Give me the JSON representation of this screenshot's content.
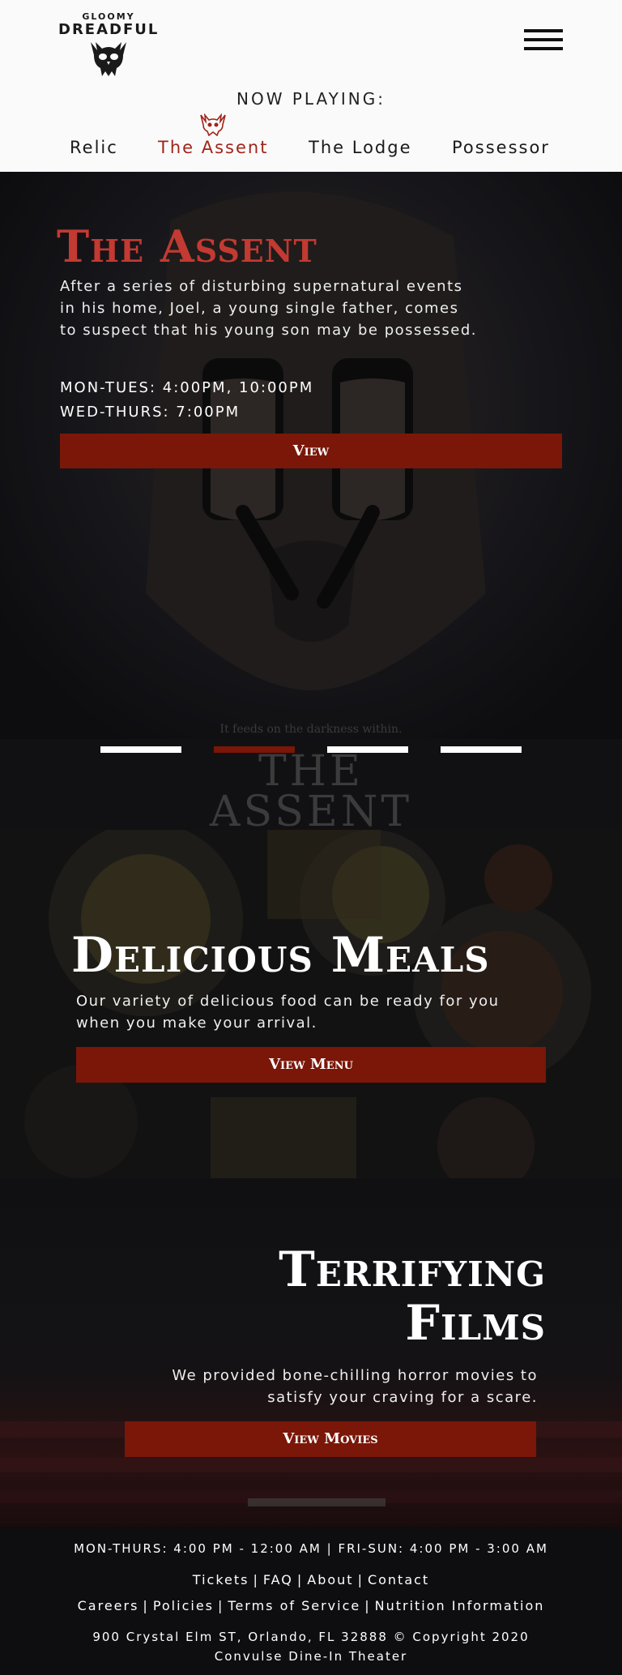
{
  "brand": {
    "top": "GLOOMY",
    "main": "DREADFUL",
    "skull_icon": "skull-icon"
  },
  "header": {
    "now_playing": "NOW PLAYING:",
    "menu_icon": "hamburger-icon"
  },
  "nav": {
    "items": [
      {
        "label": "Relic",
        "active": false
      },
      {
        "label": "The Assent",
        "active": true
      },
      {
        "label": "The Lodge",
        "active": false
      },
      {
        "label": "Possessor",
        "active": false
      }
    ]
  },
  "hero": {
    "title": "The Assent",
    "description": "After a series of disturbing supernatural events in his home, Joel, a young single father, comes to suspect that his young son may be possessed.",
    "times": [
      "MON-TUES: 4:00PM, 10:00PM",
      "WED-THURS: 7:00PM"
    ],
    "button": "View",
    "poster_tagline": "It feeds on the darkness within.",
    "poster_title": [
      "THE",
      "ASSENT"
    ],
    "slides": 4,
    "active_slide": 2
  },
  "meals": {
    "title": "Delicious Meals",
    "description": "Our variety of delicious food can be ready for you when you make your arrival.",
    "button": "View Menu"
  },
  "films": {
    "title_lines": [
      "Terrifying",
      "Films"
    ],
    "description_lines": [
      "We provided bone-chilling horror movies to",
      "satisfy your craving for a scare."
    ],
    "button": "View Movies"
  },
  "footer": {
    "hours": "MON-THURS: 4:00 PM - 12:00 AM | FRI-SUN: 4:00 PM - 3:00 AM",
    "links_row1": [
      "Tickets",
      "FAQ",
      "About",
      "Contact"
    ],
    "links_row2": [
      "Careers",
      "Policies",
      "Terms of Service",
      "Nutrition Information"
    ],
    "address_lines": [
      "900 Crystal Elm ST, Orlando, FL 32888 © Copyright 2020",
      "Convulse Dine-In Theater"
    ]
  },
  "colors": {
    "accent": "#7a1708",
    "title_red": "#c23a32",
    "nav_active": "#a0241b",
    "dark_bg": "#0e0e10",
    "header_bg": "#fafafa"
  }
}
